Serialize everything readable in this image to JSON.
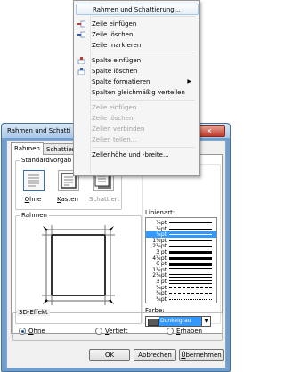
{
  "dialog": {
    "title": "Rahmen und Schatti",
    "close_glyph": "✕",
    "tabs": [
      "Rahmen",
      "Schattier"
    ],
    "standard": {
      "legend": "Standardvorgab",
      "presets": [
        {
          "label": "Ohne",
          "accel": "O",
          "rest": "hne"
        },
        {
          "label": "Kasten",
          "accel": "K",
          "rest": "asten"
        },
        {
          "label": "Schattiert",
          "accel": "",
          "rest": "Schattiert"
        }
      ]
    },
    "rahmen_legend": "Rahmen",
    "linestyle": {
      "label": "Linienart:",
      "rows": [
        "¼pt",
        "½pt",
        "¾pt",
        "1½pt",
        "2¼pt",
        "3 pt",
        "4½pt",
        "6 pt",
        "1½pt",
        "2¼pt",
        "3 pt",
        "¾pt",
        "¾pt",
        "¾pt"
      ],
      "selected_index": 2
    },
    "color": {
      "label": "Farbe:",
      "value": "Dunkelgrau",
      "swatch": "#595959"
    },
    "effect": {
      "legend": "3D-Effekt",
      "options": [
        {
          "accel": "O",
          "rest": "hne",
          "checked": true
        },
        {
          "accel": "V",
          "rest": "ertieft",
          "checked": false
        },
        {
          "accel": "E",
          "rest": "rhaben",
          "checked": false
        }
      ]
    },
    "buttons": {
      "ok": "OK",
      "cancel": "Abbrechen",
      "apply_accel": "Ü",
      "apply_rest": "bernehmen"
    }
  },
  "menu": {
    "items": [
      {
        "label": "Rahmen und Schattierung...",
        "enabled": true,
        "icon": "",
        "highlighted": true
      },
      {
        "separator": true
      },
      {
        "label": "Zeile einfügen",
        "enabled": true,
        "icon": "insert-row-icon"
      },
      {
        "label": "Zeile löschen",
        "enabled": true,
        "icon": "delete-row-icon"
      },
      {
        "label": "Zeile markieren",
        "enabled": true,
        "icon": ""
      },
      {
        "separator": true
      },
      {
        "label": "Spalte einfügen",
        "enabled": true,
        "icon": "insert-column-icon"
      },
      {
        "label": "Spalte löschen",
        "enabled": true,
        "icon": "delete-column-icon"
      },
      {
        "label": "Spalte formatieren",
        "enabled": true,
        "icon": "",
        "submenu": true
      },
      {
        "label": "Spalten gleichmäßig verteilen",
        "enabled": true,
        "icon": ""
      },
      {
        "separator": true
      },
      {
        "label": "Zeile einfügen",
        "enabled": false,
        "icon": ""
      },
      {
        "label": "Zeile löschen",
        "enabled": false,
        "icon": ""
      },
      {
        "label": "Zellen verbinden",
        "enabled": false,
        "icon": ""
      },
      {
        "label": "Zellen teilen...",
        "enabled": false,
        "icon": ""
      },
      {
        "separator": true
      },
      {
        "label": "Zellenhöhe und -breite...",
        "enabled": true,
        "icon": ""
      }
    ],
    "icon_colors": {
      "insert": "#c0392b",
      "delete": "#2a5db0"
    }
  }
}
